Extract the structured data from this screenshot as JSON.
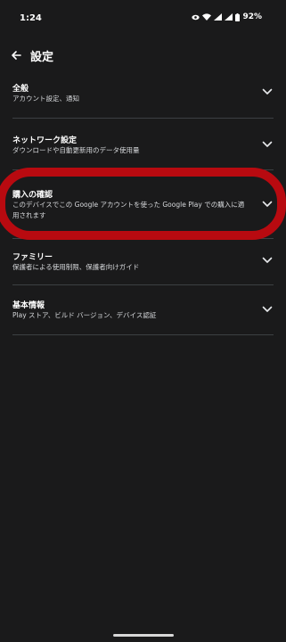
{
  "status_bar": {
    "time": "1:24",
    "battery": "92%"
  },
  "header": {
    "title": "設定"
  },
  "settings": {
    "general": {
      "title": "全般",
      "subtitle": "アカウント設定、通知"
    },
    "network": {
      "title": "ネットワーク設定",
      "subtitle": "ダウンロードや自動更新用のデータ使用量"
    },
    "purchase": {
      "title": "購入の確認",
      "subtitle": "このデバイスでこの Google アカウントを使った Google Play での購入に適用されます"
    },
    "family": {
      "title": "ファミリー",
      "subtitle": "保護者による使用制限、保護者向けガイド"
    },
    "about": {
      "title": "基本情報",
      "subtitle": "Play ストア、ビルド バージョン、デバイス認証"
    }
  },
  "colors": {
    "background": "#1a1a1b",
    "divider": "#3c4043",
    "highlight": "#b80a10"
  },
  "icons": {
    "back": "arrow-back-icon",
    "expand": "chevron-down-icon",
    "wifi": "wifi-icon",
    "signal": "signal-icon",
    "battery": "battery-icon",
    "eye": "eye-icon"
  }
}
